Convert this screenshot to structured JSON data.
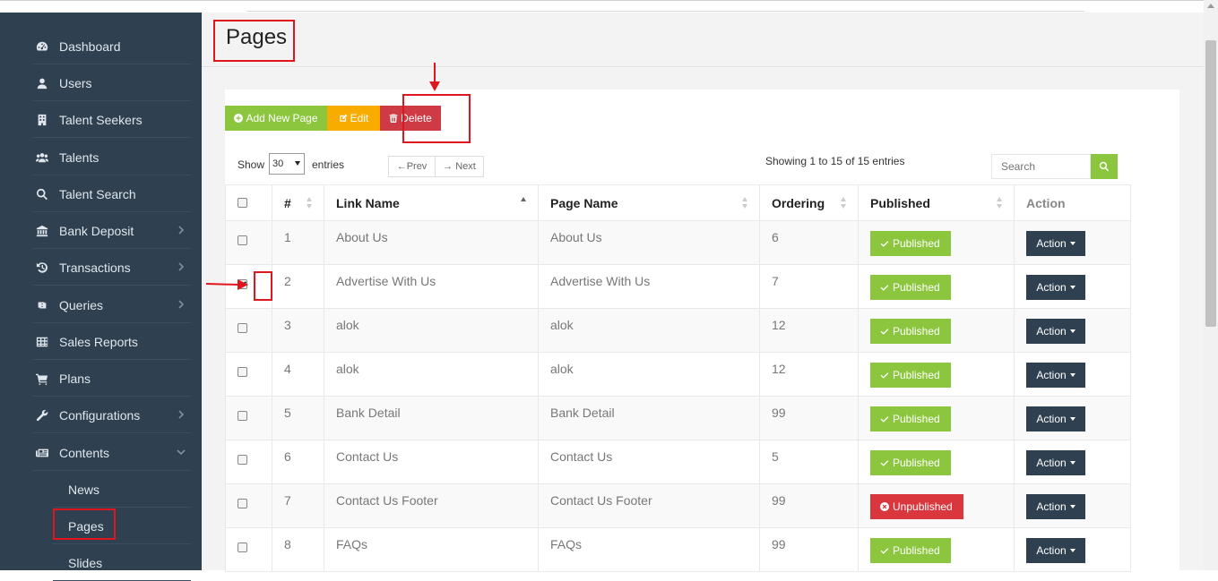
{
  "sidebar": {
    "items": [
      {
        "label": "Dashboard",
        "icon": "dashboard-icon"
      },
      {
        "label": "Users",
        "icon": "user-icon"
      },
      {
        "label": "Talent Seekers",
        "icon": "building-icon"
      },
      {
        "label": "Talents",
        "icon": "users-icon"
      },
      {
        "label": "Talent Search",
        "icon": "search-icon"
      },
      {
        "label": "Bank Deposit",
        "icon": "bank-icon"
      },
      {
        "label": "Transactions",
        "icon": "history-icon"
      },
      {
        "label": "Queries",
        "icon": "retweet-icon"
      },
      {
        "label": "Sales Reports",
        "icon": "table-icon"
      },
      {
        "label": "Plans",
        "icon": "cart-icon"
      },
      {
        "label": "Configurations",
        "icon": "wrench-icon"
      },
      {
        "label": "Contents",
        "icon": "newspaper-icon"
      }
    ],
    "subitems": [
      {
        "label": "News"
      },
      {
        "label": "Pages"
      },
      {
        "label": "Slides"
      }
    ]
  },
  "page": {
    "title": "Pages"
  },
  "toolbar": {
    "add_label": "Add New Page",
    "edit_label": "Edit",
    "delete_label": "Delete"
  },
  "length": {
    "show": "Show",
    "value": "30",
    "entries": "entries"
  },
  "pager": {
    "prev": "←Prev",
    "next": "→ Next"
  },
  "info": "Showing 1 to 15 of 15 entries",
  "search": {
    "placeholder": "Search"
  },
  "table": {
    "headers": [
      "#",
      "Link Name",
      "Page Name",
      "Ordering",
      "Published",
      "Action"
    ],
    "rows": [
      {
        "num": "1",
        "link": "About Us",
        "page": "About Us",
        "ordering": "6",
        "status": "Published",
        "action": "Action"
      },
      {
        "num": "2",
        "link": "Advertise With Us",
        "page": "Advertise With Us",
        "ordering": "7",
        "status": "Published",
        "action": "Action"
      },
      {
        "num": "3",
        "link": "alok",
        "page": "alok",
        "ordering": "12",
        "status": "Published",
        "action": "Action"
      },
      {
        "num": "4",
        "link": "alok",
        "page": "alok",
        "ordering": "12",
        "status": "Published",
        "action": "Action"
      },
      {
        "num": "5",
        "link": "Bank Detail",
        "page": "Bank Detail",
        "ordering": "99",
        "status": "Published",
        "action": "Action"
      },
      {
        "num": "6",
        "link": "Contact Us",
        "page": "Contact Us",
        "ordering": "5",
        "status": "Published",
        "action": "Action"
      },
      {
        "num": "7",
        "link": "Contact Us Footer",
        "page": "Contact Us Footer",
        "ordering": "99",
        "status": "Unpublished",
        "action": "Action"
      },
      {
        "num": "8",
        "link": "FAQs",
        "page": "FAQs",
        "ordering": "99",
        "status": "Published",
        "action": "Action"
      }
    ]
  },
  "colors": {
    "sidebar_bg": "#2f4050",
    "add_button": "#8cc63f",
    "edit_button": "#f8ac00",
    "delete_button": "#cf3b45",
    "published": "#8cc63f",
    "unpublished": "#d9363e",
    "action_button": "#2f4050",
    "annotation": "#e0161f"
  }
}
